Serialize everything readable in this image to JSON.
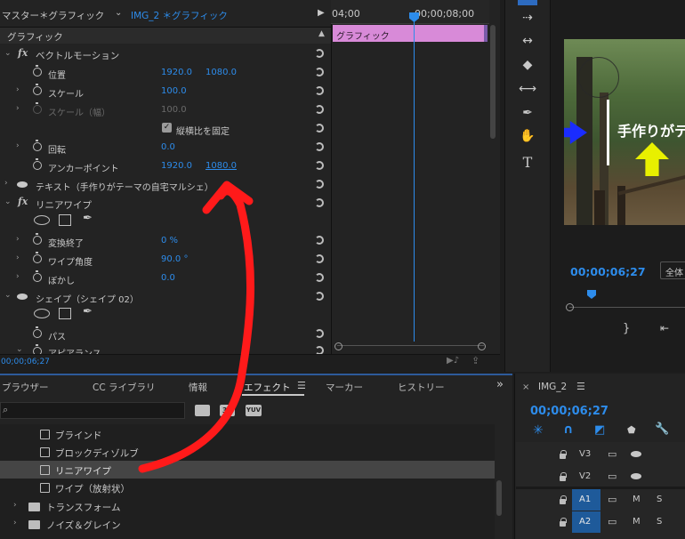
{
  "effect_controls": {
    "source_tab": "マスター＊グラフィック",
    "clip_tab": "IMG_2 ＊グラフィック",
    "section_title": "グラフィック",
    "vector_motion": "ベクトルモーション",
    "position_label": "位置",
    "position_x": "1920.0",
    "position_y": "1080.0",
    "scale_label": "スケール",
    "scale_value": "100.0",
    "scale_width_label": "スケール（幅）",
    "scale_width_value": "100.0",
    "uniform_scale_label": "縦横比を固定",
    "rotation_label": "回転",
    "rotation_value": "0.0",
    "anchor_label": "アンカーポイント",
    "anchor_x": "1920.0",
    "anchor_y": "1080.0",
    "text_layer": "テキスト（手作りがテーマの自宅マルシェ）",
    "linear_wipe": "リニアワイプ",
    "transition_label": "変換終了",
    "transition_value": "0 %",
    "wipe_angle_label": "ワイプ角度",
    "wipe_angle_value": "90.0 °",
    "feather_label": "ぼかし",
    "feather_value": "0.0",
    "shape_layer": "シェイプ（シェイプ 02）",
    "path_label": "パス",
    "appearance_label": "アピアランス",
    "timecode": "00;00;06;27"
  },
  "mini_timeline": {
    "time_left": "04;00",
    "time_right": "00;00;08;00",
    "clip_label": "グラフィック"
  },
  "program": {
    "video_text": "手作りがテ",
    "timecode": "00;00;06;27",
    "fit_label": "全体"
  },
  "effects_panel": {
    "tabs": [
      "ブラウザー",
      "CC ライブラリ",
      "情報",
      "エフェクト",
      "マーカー",
      "ヒストリー"
    ],
    "items": [
      "ブラインド",
      "ブロックディゾルブ",
      "リニアワイプ",
      "ワイプ（放射状）"
    ],
    "folders": [
      "トランスフォーム",
      "ノイズ＆グレイン"
    ],
    "badge_32": "32",
    "badge_yuv": "YUV"
  },
  "timeline": {
    "title": "IMG_2",
    "timecode": "00;00;06;27",
    "tracks": [
      "V3",
      "V2",
      "A1",
      "A2"
    ],
    "m_label": "M",
    "s_label": "S"
  },
  "colors": {
    "accent_blue": "#2d8ceb",
    "clip_pink": "#d88ad8",
    "annotation_red": "#ff1a1a"
  }
}
